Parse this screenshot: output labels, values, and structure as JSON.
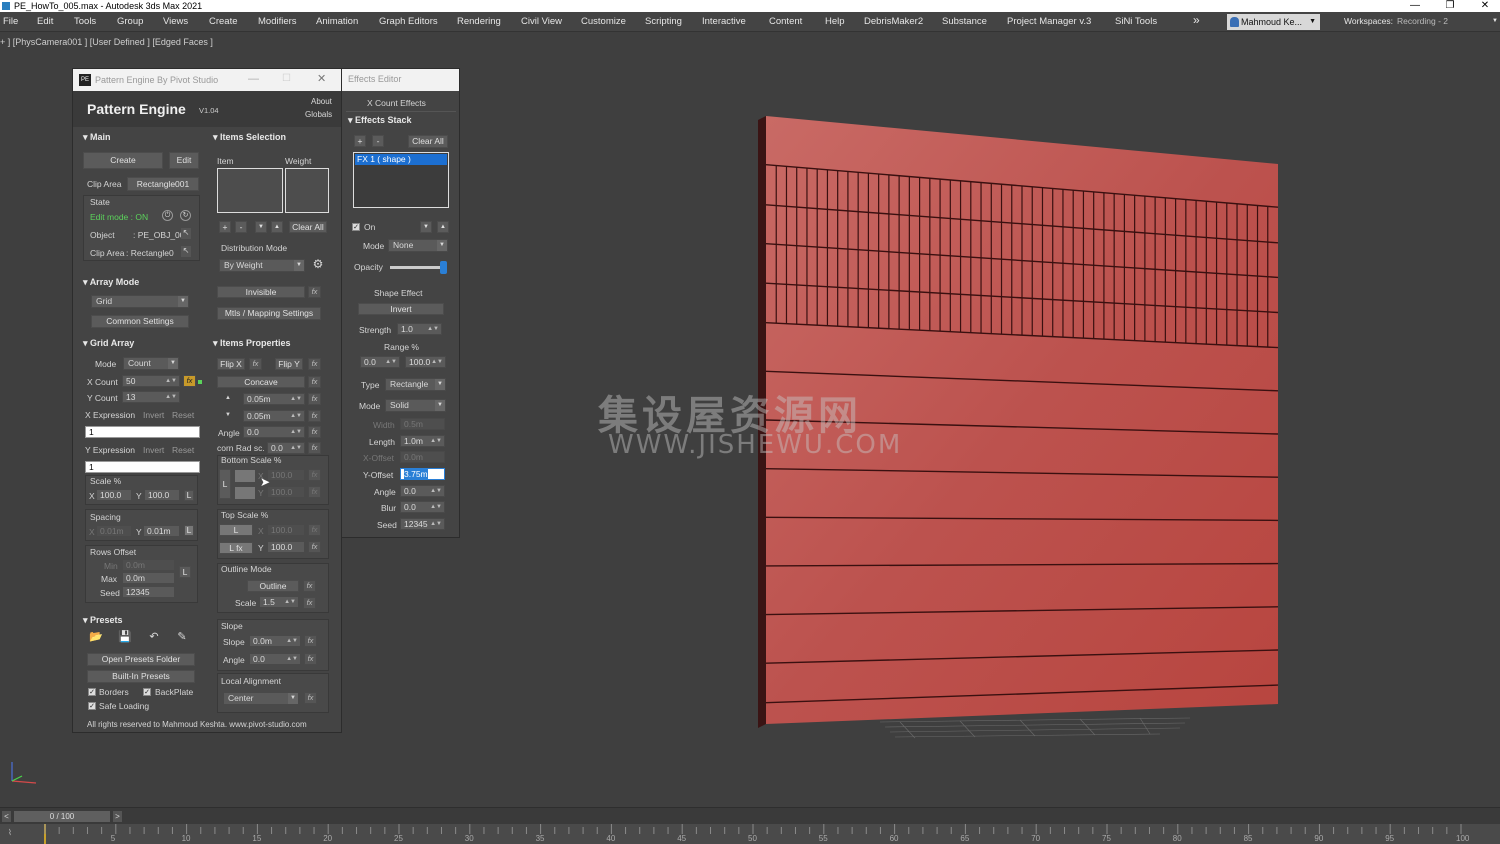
{
  "window": {
    "title": "PE_HowTo_005.max - Autodesk 3ds Max 2021"
  },
  "menu": [
    "File",
    "Edit",
    "Tools",
    "Group",
    "Views",
    "Create",
    "Modifiers",
    "Animation",
    "Graph Editors",
    "Rendering",
    "Civil View",
    "Customize",
    "Scripting",
    "Interactive",
    "Content",
    "Help",
    "DebrisMaker2",
    "Substance",
    "Project Manager v.3",
    "SiNi Tools"
  ],
  "menu_more": "»",
  "user": "Mahmoud Ke...",
  "workspaces": {
    "label": "Workspaces:",
    "value": "Recording - 2"
  },
  "viewport_label": "+ ] [PhysCamera001 ] [User Defined ] [Edged Faces ]",
  "pe": {
    "window_title": "Pattern Engine By Pivot Studio",
    "logo": "PE",
    "brand": "Pattern Engine",
    "version": "V1.04",
    "about": "About",
    "globals": "Globals",
    "main": {
      "head": "Main",
      "create": "Create",
      "edit": "Edit",
      "clip_area_label": "Clip Area",
      "clip_area_value": "Rectangle001",
      "state": "State",
      "edit_mode": "Edit mode : ON",
      "object_label": "Object",
      "object_value": ": PE_OBJ_00",
      "clip_label": "Clip Area",
      "clip_value": ": Rectangle0"
    },
    "array_mode": {
      "head": "Array Mode",
      "value": "Grid",
      "common": "Common Settings"
    },
    "grid_array": {
      "head": "Grid Array",
      "mode_label": "Mode",
      "mode_value": "Count",
      "xcount_label": "X Count",
      "xcount": "50",
      "ycount_label": "Y Count",
      "ycount": "13",
      "xexpr_label": "X Expression",
      "yexpr_label": "Y Expression",
      "invert": "Invert",
      "reset": "Reset",
      "xexpr_value": "1",
      "yexpr_value": "1",
      "scale_label": "Scale %",
      "scale_x": "100.0",
      "scale_y": "100.0",
      "x": "X",
      "y": "Y",
      "l": "L",
      "spacing_label": "Spacing",
      "spacing_x": "0.01m",
      "spacing_y": "0.01m",
      "rows_offset": "Rows Offset",
      "min_label": "Min",
      "min": "0.0m",
      "max_label": "Max",
      "max": "0.0m",
      "seed_label": "Seed",
      "seed": "12345"
    },
    "presets": {
      "head": "Presets",
      "open_folder": "Open Presets Folder",
      "builtin": "Built-In Presets",
      "borders": "Borders",
      "backplate": "BackPlate",
      "safe_loading": "Safe Loading"
    },
    "footer": "All rights reserved to Mahmoud Keshta. www.pivot-studio.com",
    "items_selection": {
      "head": "Items Selection",
      "item": "Item",
      "weight": "Weight",
      "clear_all": "Clear All",
      "dist_label": "Distribution Mode",
      "dist_value": "By Weight",
      "invisible": "Invisible",
      "mtls": "Mtls / Mapping Settings",
      "plus": "+",
      "minus": "-",
      "down": "▼",
      "up": "▲"
    },
    "items_properties": {
      "head": "Items Properties",
      "flip_x": "Flip X",
      "flip_y": "Flip Y",
      "concave": "Concave",
      "val1": "0.05m",
      "val2": "0.05m",
      "angle_label": "Angle",
      "angle": "0.0",
      "corn_label": "corn Rad sc.",
      "corn": "0.0",
      "bottom_scale": "Bottom Scale %",
      "bs_x": "100.0",
      "bs_y": "100.0",
      "top_scale": "Top Scale %",
      "ts_x": "100.0",
      "ts_y": "100.0",
      "l": "L",
      "lfx": "L fx",
      "x": "X",
      "y": "Y",
      "outline_mode": "Outline Mode",
      "outline": "Outline",
      "scale_label": "Scale",
      "scale": "1.5",
      "slope_head": "Slope",
      "slope_label": "Slope",
      "slope": "0.0m",
      "slope_angle_label": "Angle",
      "slope_angle": "0.0",
      "local_align": "Local Alignment",
      "align_value": "Center",
      "fx": "fx"
    }
  },
  "fx": {
    "window_title": "Effects Editor",
    "tabs": "X Count  Effects",
    "stack_head": "Effects Stack",
    "plus": "+",
    "minus": "-",
    "clear_all": "Clear All",
    "stack_item": "FX 1  ( shape )",
    "on_label": "On",
    "mode_label": "Mode",
    "mode_value": "None",
    "opacity_label": "Opacity",
    "shape_effect": "Shape Effect",
    "invert": "Invert",
    "strength_label": "Strength",
    "strength": "1.0",
    "range_label": "Range %",
    "range_min": "0.0",
    "range_max": "100.0",
    "type_label": "Type",
    "type_value": "Rectangle",
    "mode2_label": "Mode",
    "mode2_value": "Solid",
    "width_label": "Width",
    "width": "0.5m",
    "length_label": "Length",
    "length": "1.0m",
    "xoffset_label": "X-Offset",
    "xoffset": "0.0m",
    "yoffset_label": "Y-Offset",
    "yoffset": "3.75m",
    "angle_label": "Angle",
    "angle": "0.0",
    "blur_label": "Blur",
    "blur": "0.0",
    "seed_label": "Seed",
    "seed": "12345",
    "opacity_level": 1.0
  },
  "watermark": {
    "line1": "集设屋资源网",
    "line2": "WWW.JISHEWU.COM"
  },
  "timeline": {
    "frame": "0 / 100",
    "ticks": [
      "5",
      "10",
      "15",
      "20",
      "25",
      "30",
      "35",
      "40",
      "45",
      "50",
      "55",
      "60",
      "65",
      "70",
      "75",
      "80",
      "85",
      "90",
      "95",
      "100"
    ]
  },
  "colors": {
    "wall": "#c0504d",
    "bg": "#3f3f3f",
    "panel": "#444444",
    "edit_mode": "#5bd35b",
    "selection": "#1c6fd1"
  }
}
